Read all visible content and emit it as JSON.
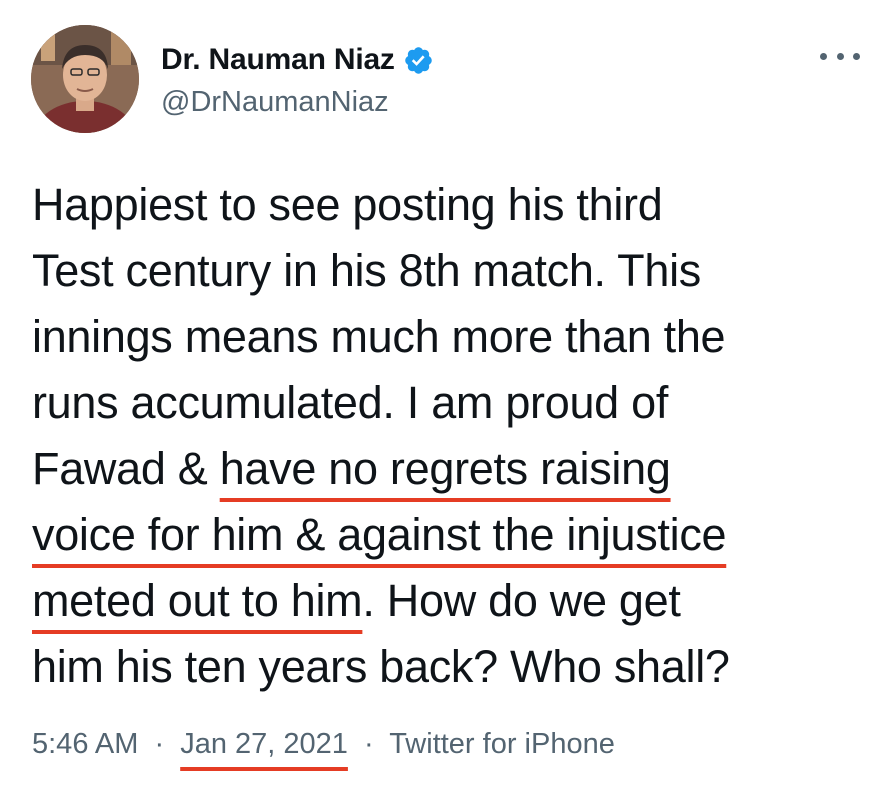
{
  "author": {
    "display_name": "Dr. Nauman Niaz",
    "handle": "@DrNaumanNiaz",
    "verified": true,
    "verified_color": "#1d9bf0",
    "avatar_icon": "profile-photo"
  },
  "more_icon": "more-horizontal-icon",
  "tweet": {
    "lines": [
      "Happiest to see posting his third",
      "Test century in his 8th match. This",
      "innings means much more than the",
      "runs accumulated. I am proud of"
    ],
    "line5_plain": "Fawad & ",
    "line5_underlined": "have no regrets raising",
    "line6_underlined": "voice for him & against the injustice",
    "line7_underlined": "meted out to him",
    "line7_plain": ". How do we get",
    "line8": "him his ten years back? Who shall?"
  },
  "meta": {
    "time": "5:46 AM",
    "separator": "·",
    "date": "Jan 27, 2021",
    "source": "Twitter for iPhone"
  },
  "colors": {
    "text": "#0f1419",
    "secondary": "#536471",
    "underline_annotation": "#e53c24"
  }
}
